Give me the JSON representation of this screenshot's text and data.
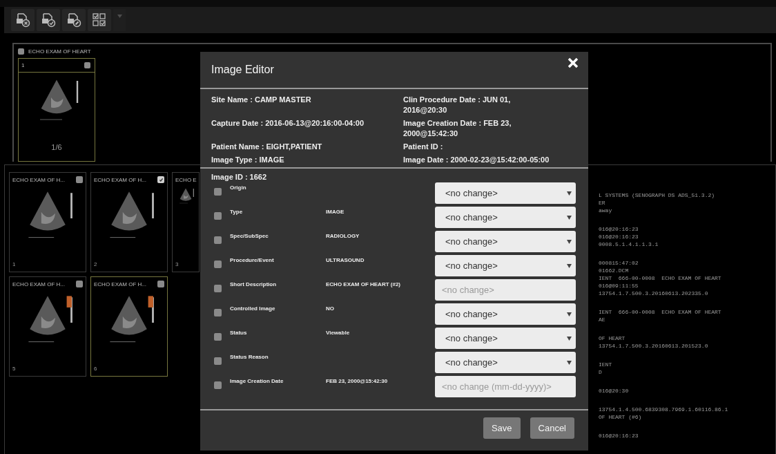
{
  "toolbar": {
    "menu_disabled": true
  },
  "study": {
    "title": "ECHO EXAM OF HEART",
    "checked": false,
    "preview": {
      "number": "1",
      "checked": false,
      "selected": true,
      "counter": "1/6"
    }
  },
  "thumbnails": [
    {
      "title": "ECHO EXAM OF H...",
      "checked": false,
      "number": "1",
      "selected": false,
      "doppler": false
    },
    {
      "title": "ECHO EXAM OF H...",
      "checked": true,
      "number": "2",
      "selected": false,
      "doppler": false
    },
    {
      "title": "ECHO E",
      "number": "3",
      "selected": false,
      "doppler": false
    },
    {
      "title": "ECHO EXAM OF H...",
      "checked": false,
      "number": "5",
      "selected": false,
      "doppler": true
    },
    {
      "title": "ECHO EXAM OF H...",
      "checked": false,
      "number": "6",
      "selected": true,
      "doppler": true
    }
  ],
  "details_lines": [
    [
      "L SYSTEMS (SENOGRAPH DS ADS_51.3.2)",
      "ER",
      "away"
    ],
    [
      "016@20:16:23",
      "016@20:16:23",
      "0008.5.1.4.1.1.3.1"
    ],
    [
      "000815:47:02",
      "01662.DCM",
      "IENT  666-00-0008  ECHO EXAM OF HEART",
      "016@09:11:55",
      "13754.1.7.500.3.20160613.202335.0"
    ],
    [
      "IENT  666-00-0008  ECHO EXAM OF HEART",
      "AE"
    ],
    [
      "OF HEART",
      "13754.1.7.500.3.20160613.201523.0"
    ],
    [
      "IENT",
      "D"
    ],
    [
      "016@20:30"
    ],
    [
      "13754.1.4.500.6839308.7969.1.60116.86.1",
      "OF HEART (#6)"
    ],
    [
      "016@20:16:23"
    ]
  ],
  "dialog": {
    "title": "Image Editor",
    "info": [
      [
        "Site Name : CAMP MASTER",
        "Clin Procedure Date : JUN 01, 2016@20:30"
      ],
      [
        "Capture Date : 2016-06-13@20:16:00-04:00",
        "Image Creation Date : FEB 23, 2000@15:42:30"
      ],
      [
        "Patient Name : EIGHT,PATIENT",
        "Patient ID :"
      ],
      [
        "Image Type : IMAGE",
        "Image Date : 2000-02-23@15:42:00-05:00"
      ]
    ],
    "image_id": "Image ID : 1662",
    "fields": [
      {
        "label": "Origin",
        "checked": false,
        "kind": "select",
        "choice": "<no change>"
      },
      {
        "label": "Type",
        "value": "IMAGE",
        "checked": false,
        "kind": "select",
        "choice": "<no change>"
      },
      {
        "label": "Spec/SubSpec",
        "value": "RADIOLOGY",
        "checked": false,
        "kind": "select",
        "choice": "<no change>"
      },
      {
        "label": "Procedure/Event",
        "value": "ULTRASOUND",
        "checked": false,
        "kind": "select",
        "choice": "<no change>"
      },
      {
        "label": "Short Description",
        "value": "ECHO EXAM OF HEART (#2)",
        "checked": false,
        "kind": "text",
        "placeholder": "<no change>"
      },
      {
        "label": "Controlled Image",
        "value": "NO",
        "checked": false,
        "kind": "select",
        "choice": "<no change>"
      },
      {
        "label": "Status",
        "value": "Viewable",
        "checked": false,
        "kind": "select",
        "choice": "<no change>"
      },
      {
        "label": "Status Reason",
        "checked": false,
        "kind": "select",
        "choice": "<no change>"
      },
      {
        "label": "Image Creation Date",
        "value": "FEB 23, 2000@15:42:30",
        "checked": false,
        "kind": "text",
        "placeholder": "<no change (mm-dd-yyyy)>"
      }
    ],
    "buttons": [
      "Save",
      "Cancel"
    ]
  }
}
